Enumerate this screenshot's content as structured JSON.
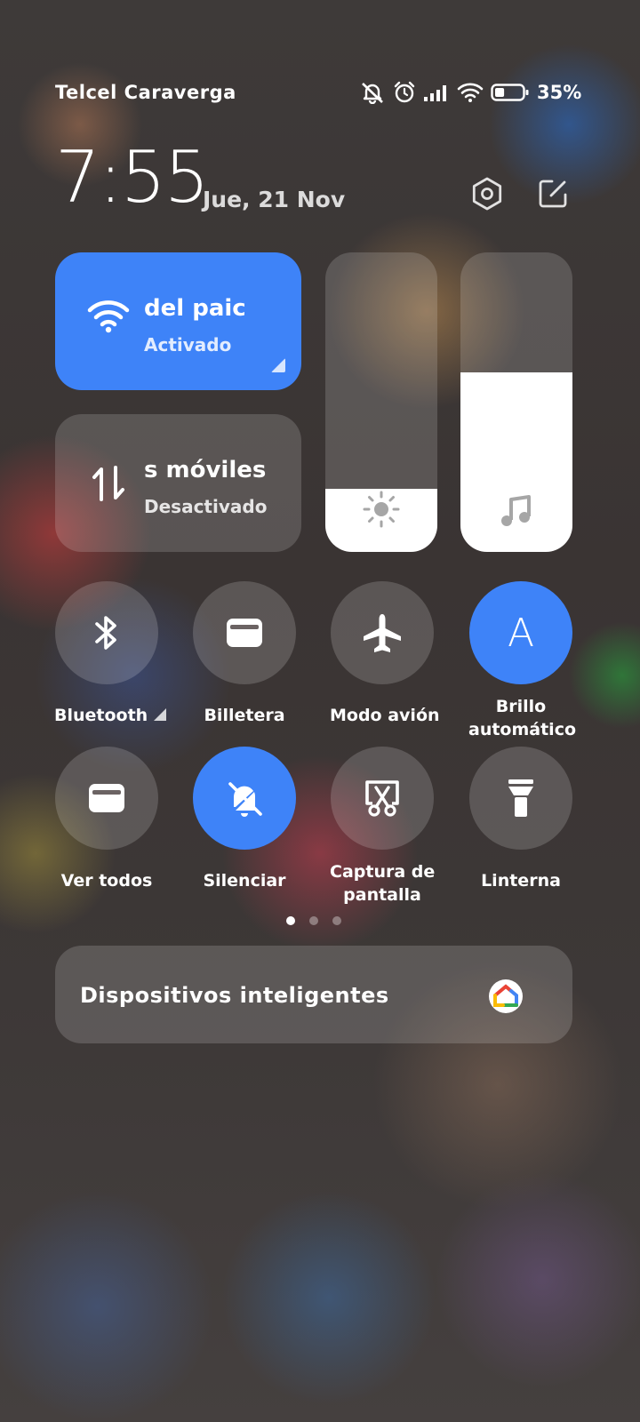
{
  "status_bar": {
    "carrier": "Telcel Caraverga",
    "battery_percent": "35%",
    "battery_level": 0.35,
    "icons": [
      "bell-off-icon",
      "alarm-icon",
      "cellular-signal-icon",
      "wifi-icon",
      "battery-icon"
    ]
  },
  "header": {
    "time": "7:55",
    "date": "Jue, 21 Nov",
    "settings_icon": "settings-icon",
    "edit_icon": "edit-icon"
  },
  "tiles": {
    "wifi": {
      "title": "del paic",
      "subtitle": "Activado",
      "icon": "wifi-icon",
      "active": true
    },
    "mobile_data": {
      "title": "s móviles",
      "subtitle": "Desactivado",
      "icon": "data-arrows-icon",
      "active": false
    }
  },
  "sliders": {
    "brightness": {
      "icon": "sun-icon",
      "level": 0.21
    },
    "volume": {
      "icon": "music-note-icon",
      "level": 0.6
    }
  },
  "toggles": [
    {
      "label": "Bluetooth",
      "icon": "bluetooth-icon",
      "active": false
    },
    {
      "label": "Billetera",
      "icon": "wallet-icon",
      "active": false
    },
    {
      "label": "Modo avión",
      "icon": "airplane-icon",
      "active": false
    },
    {
      "label": "Brillo automático",
      "icon": "auto-brightness-icon",
      "active": true,
      "glyph": "A"
    },
    {
      "label": "Ver todos",
      "icon": "wallet-icon",
      "active": false
    },
    {
      "label": "Silenciar",
      "icon": "bell-off-icon",
      "active": true
    },
    {
      "label": "Captura de pantalla",
      "icon": "screenshot-icon",
      "active": false
    },
    {
      "label": "Linterna",
      "icon": "flashlight-icon",
      "active": false
    }
  ],
  "toggle_labels": {
    "brillo_line1": "Brillo",
    "brillo_line2": "automático",
    "captura_line1": "Captura de",
    "captura_line2": "pantalla"
  },
  "pager": {
    "pages": 3,
    "current": 1
  },
  "devices": {
    "label": "Dispositivos inteligentes",
    "icon": "google-home-icon"
  },
  "colors": {
    "accent": "#3e83f8",
    "tile_bg": "rgba(255,255,255,0.16)"
  }
}
